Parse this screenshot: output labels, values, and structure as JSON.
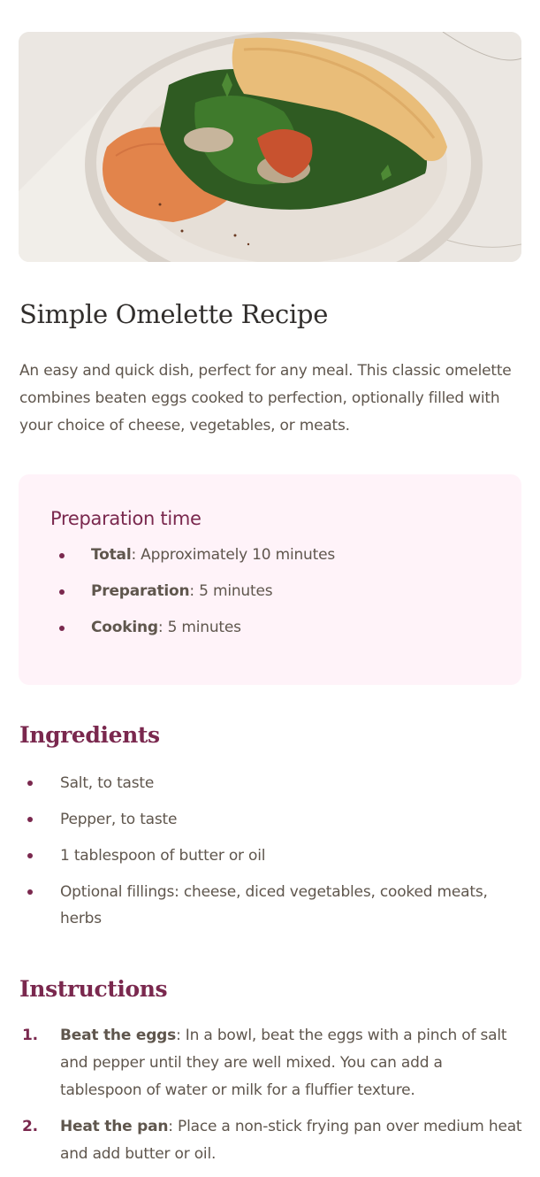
{
  "recipe": {
    "image_alt": "Omelette with spinach, mushrooms and hummus on a plate",
    "title": "Simple Omelette Recipe",
    "description": "An easy and quick dish, perfect for any meal. This classic omelette combines beaten eggs cooked to perfection, optionally filled with your choice of cheese, vegetables, or meats."
  },
  "preparation": {
    "heading": "Preparation time",
    "items": [
      {
        "label": "Total",
        "value": ": Approximately 10 minutes"
      },
      {
        "label": "Preparation",
        "value": ": 5 minutes"
      },
      {
        "label": "Cooking",
        "value": ": 5 minutes"
      }
    ]
  },
  "ingredients": {
    "heading": "Ingredients",
    "items": [
      "Salt, to taste",
      "Pepper, to taste",
      "1 tablespoon of butter or oil",
      "Optional fillings: cheese, diced vegetables, cooked meats, herbs"
    ]
  },
  "instructions": {
    "heading": "Instructions",
    "steps": [
      {
        "number": "1.",
        "title": "Beat the eggs",
        "text": ": In a bowl, beat the eggs with a pinch of salt and pepper until they are well mixed. You can add a tablespoon of water or milk for a fluffier texture."
      },
      {
        "number": "2.",
        "title": "Heat the pan",
        "text": ": Place a non-stick frying pan over medium heat and add butter or oil."
      }
    ]
  },
  "colors": {
    "accent": "#7a284e",
    "heading": "#312e2c",
    "body_text": "#5f564d",
    "prep_background": "#fff3f9"
  }
}
